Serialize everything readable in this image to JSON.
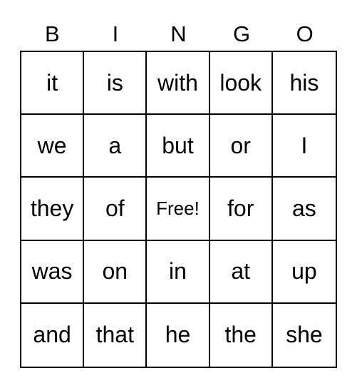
{
  "card": {
    "header_letters": [
      "B",
      "I",
      "N",
      "G",
      "O"
    ],
    "rows": [
      [
        "it",
        "is",
        "with",
        "look",
        "his"
      ],
      [
        "we",
        "a",
        "but",
        "or",
        "I"
      ],
      [
        "they",
        "of",
        "Free!",
        "for",
        "as"
      ],
      [
        "was",
        "on",
        "in",
        "at",
        "up"
      ],
      [
        "and",
        "that",
        "he",
        "the",
        "she"
      ]
    ],
    "free_space": {
      "row": 2,
      "col": 2,
      "label": "Free!"
    }
  }
}
